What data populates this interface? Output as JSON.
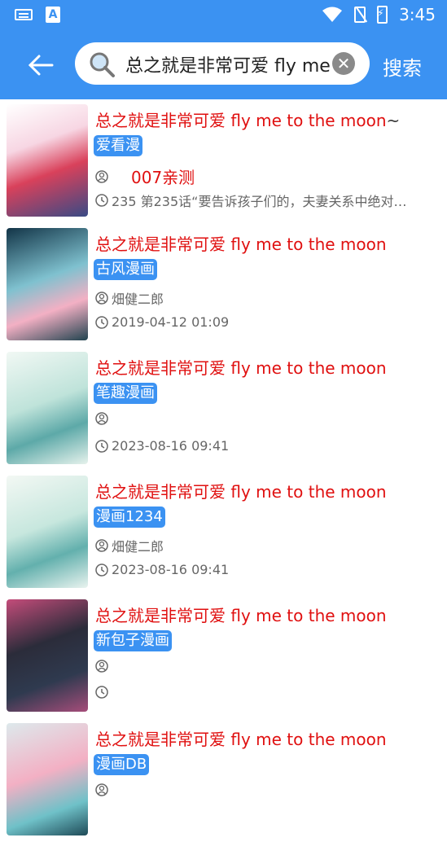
{
  "status_bar": {
    "time": "3:45"
  },
  "search": {
    "value": "总之就是非常可爱 fly me",
    "button_label": "搜索"
  },
  "results": [
    {
      "title": "总之就是非常可爱 fly me to the moon",
      "title_tail": "~",
      "source": "爱看漫",
      "author": "",
      "author_extra": "007亲测",
      "time": "235 第235话“要告诉孩子们的，夫妻关系中绝对…"
    },
    {
      "title": "总之就是非常可爱 fly me to the moon",
      "title_tail": "",
      "source": "古风漫画",
      "author": "畑健二郎",
      "author_extra": "",
      "time": "2019-04-12 01:09"
    },
    {
      "title": "总之就是非常可爱 fly me to the moon",
      "title_tail": "",
      "source": "笔趣漫画",
      "author": "",
      "author_extra": "",
      "time": "2023-08-16 09:41"
    },
    {
      "title": "总之就是非常可爱 fly me to the moon",
      "title_tail": "",
      "source": "漫画1234",
      "author": "畑健二郎",
      "author_extra": "",
      "time": "2023-08-16 09:41"
    },
    {
      "title": "总之就是非常可爱 fly me to the moon",
      "title_tail": "",
      "source": "新包子漫画",
      "author": "",
      "author_extra": "",
      "time": ""
    },
    {
      "title": "总之就是非常可爱 fly me to the moon",
      "title_tail": "",
      "source": "漫画DB",
      "author": "",
      "author_extra": "",
      "time": ""
    }
  ]
}
